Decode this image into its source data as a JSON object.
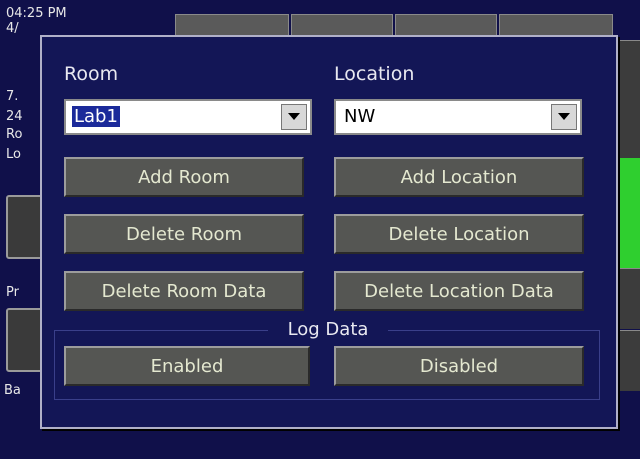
{
  "background": {
    "time": "04:25 PM",
    "date_fragment": "4/",
    "left_fragments": [
      "7.",
      "24",
      "Ro",
      "Lo"
    ],
    "pr_fragment": "Pr",
    "ba_fragment": "Ba"
  },
  "dialog": {
    "room_label": "Room",
    "location_label": "Location",
    "room_select": {
      "value": "Lab1"
    },
    "location_select": {
      "value": "NW"
    },
    "buttons": {
      "add_room": "Add Room",
      "add_location": "Add Location",
      "delete_room": "Delete Room",
      "delete_location": "Delete Location",
      "delete_room_data": "Delete Room Data",
      "delete_location_data": "Delete Location Data"
    },
    "log_data": {
      "title": "Log Data",
      "enabled": "Enabled",
      "disabled": "Disabled"
    }
  },
  "colors": {
    "background": "#10104a",
    "dialog": "#131656",
    "button": "#555653",
    "button_text": "#e4e8d0",
    "green_indicator": "#2fcf2f"
  }
}
